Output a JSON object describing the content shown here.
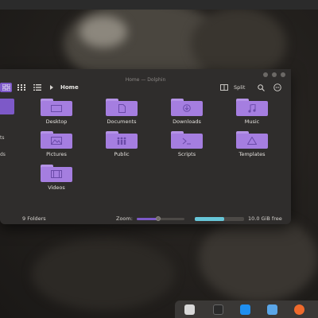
{
  "window": {
    "title": "Home — Dolphin"
  },
  "toolbar": {
    "breadcrumb": "Home",
    "split_label": "Split"
  },
  "sidebar": {
    "items": [
      {
        "label": "ts"
      },
      {
        "label": "ds"
      }
    ]
  },
  "folders": [
    {
      "name": "Desktop",
      "icon": "desktop-icon"
    },
    {
      "name": "Documents",
      "icon": "document-icon"
    },
    {
      "name": "Downloads",
      "icon": "download-icon"
    },
    {
      "name": "Music",
      "icon": "music-icon"
    },
    {
      "name": "Pictures",
      "icon": "picture-icon"
    },
    {
      "name": "Public",
      "icon": "people-icon"
    },
    {
      "name": "Scripts",
      "icon": "terminal-icon"
    },
    {
      "name": "Templates",
      "icon": "template-icon"
    },
    {
      "name": "Videos",
      "icon": "film-icon"
    }
  ],
  "status": {
    "folder_count": "9 Folders",
    "zoom_label": "Zoom:",
    "zoom_level": 0.45,
    "storage_used": 0.6,
    "free_space": "10.0 GiB free"
  },
  "colors": {
    "accent": "#7d59c8",
    "folder": "#a57ee0",
    "storage_bar": "#67c6d8"
  },
  "dock": {
    "apps": [
      "settings-icon",
      "terminal-icon",
      "app-store-icon",
      "files-icon",
      "firefox-icon"
    ]
  }
}
